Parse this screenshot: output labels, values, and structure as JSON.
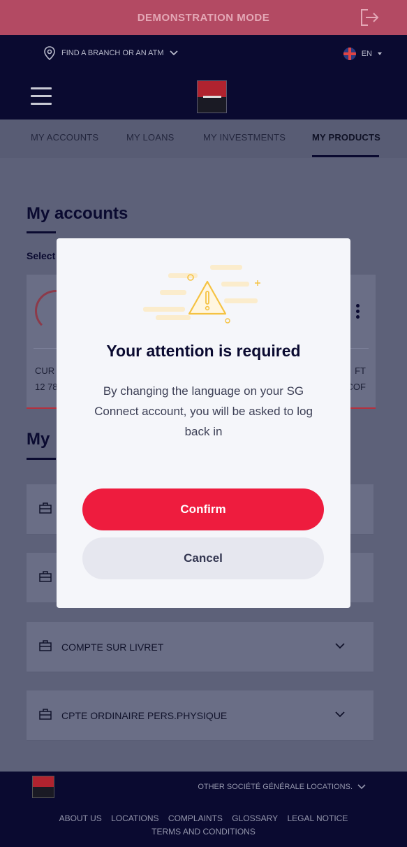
{
  "demo_banner": {
    "text": "DEMONSTRATION MODE"
  },
  "top_bar": {
    "branch_link": "FIND A BRANCH OR AN ATM",
    "language": "EN"
  },
  "tabs": [
    {
      "label": "MY ACCOUNTS"
    },
    {
      "label": "MY LOANS"
    },
    {
      "label": "MY INVESTMENTS"
    },
    {
      "label": "MY PRODUCTS",
      "active": true
    }
  ],
  "main": {
    "accounts_title": "My accounts",
    "select_label": "Select",
    "account_card": {
      "left_label": "CUR",
      "left_value": "12 78",
      "right_label": "FT",
      "right_value": "COF"
    },
    "products_title": "My",
    "products": [
      {
        "label": ""
      },
      {
        "label": ""
      },
      {
        "label": "COMPTE SUR LIVRET"
      },
      {
        "label": "CPTE ORDINAIRE PERS.PHYSIQUE"
      }
    ]
  },
  "footer": {
    "other_locations": "OTHER SOCIÉTÉ GÉNÉRALE LOCATIONS.",
    "links": [
      "ABOUT US",
      "LOCATIONS",
      "COMPLAINTS",
      "GLOSSARY",
      "LEGAL NOTICE",
      "TERMS AND CONDITIONS"
    ]
  },
  "modal": {
    "title": "Your attention is required",
    "message": "By changing the language on your SG Connect account, you will be asked to log back in",
    "confirm_label": "Confirm",
    "cancel_label": "Cancel"
  },
  "colors": {
    "brand_red": "#ee1c3e",
    "navy": "#0a0a30",
    "warning_yellow": "#f5c242"
  }
}
